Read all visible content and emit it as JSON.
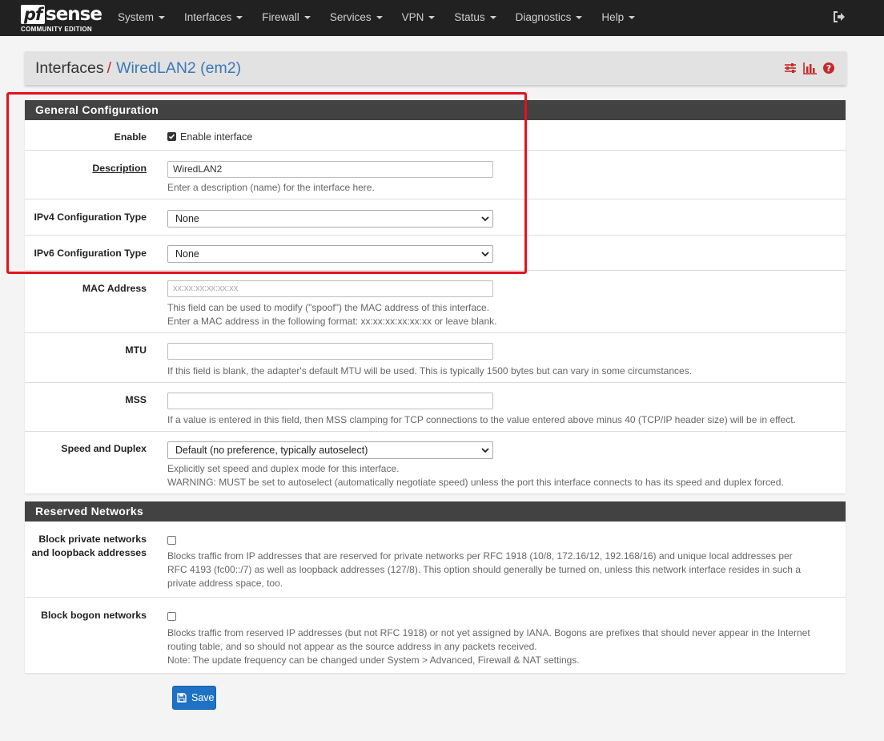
{
  "nav": {
    "logo_brand": "pfsense",
    "logo_pf": "pf",
    "logo_sense": "sense",
    "logo_edition": "COMMUNITY EDITION",
    "menu": [
      "System",
      "Interfaces",
      "Firewall",
      "Services",
      "VPN",
      "Status",
      "Diagnostics",
      "Help"
    ],
    "logout_icon": "sign-out-icon"
  },
  "breadcrumb": {
    "first": "Interfaces",
    "separator": "/",
    "current": "WiredLAN2 (em2)",
    "icons": [
      "sliders-icon",
      "bar-chart-icon",
      "question-circle-icon"
    ]
  },
  "general": {
    "heading": "General Configuration",
    "enable": {
      "label": "Enable",
      "checkbox_label": "Enable interface",
      "checked": true
    },
    "description": {
      "label": "Description",
      "value": "WiredLAN2",
      "help": "Enter a description (name) for the interface here."
    },
    "ipv4": {
      "label": "IPv4 Configuration Type",
      "value": "None"
    },
    "ipv6": {
      "label": "IPv6 Configuration Type",
      "value": "None"
    },
    "mac": {
      "label": "MAC Address",
      "placeholder": "xx:xx:xx:xx:xx:xx",
      "help1": "This field can be used to modify (\"spoof\") the MAC address of this interface.",
      "help2": "Enter a MAC address in the following format: xx:xx:xx:xx:xx:xx or leave blank."
    },
    "mtu": {
      "label": "MTU",
      "value": "",
      "help": "If this field is blank, the adapter's default MTU will be used. This is typically 1500 bytes but can vary in some circumstances."
    },
    "mss": {
      "label": "MSS",
      "value": "",
      "help": "If a value is entered in this field, then MSS clamping for TCP connections to the value entered above minus 40 (TCP/IP header size) will be in effect."
    },
    "speed": {
      "label": "Speed and Duplex",
      "value": "Default (no preference, typically autoselect)",
      "help1": "Explicitly set speed and duplex mode for this interface.",
      "help2": "WARNING: MUST be set to autoselect (automatically negotiate speed) unless the port this interface connects to has its speed and duplex forced."
    }
  },
  "reserved": {
    "heading": "Reserved Networks",
    "private": {
      "label1": "Block private networks",
      "label2": "and loopback addresses",
      "checked": false,
      "help1": "Blocks traffic from IP addresses that are reserved for private networks per RFC 1918 (10/8, 172.16/12, 192.168/16) and unique local addresses per",
      "help2": "RFC 4193 (fc00::/7) as well as loopback addresses (127/8). This option should generally be turned on, unless this network interface resides in such a",
      "help3": "private address space, too."
    },
    "bogon": {
      "label": "Block bogon networks",
      "checked": false,
      "help1": "Blocks traffic from reserved IP addresses (but not RFC 1918) or not yet assigned by IANA. Bogons are prefixes that should never appear in the Internet",
      "help2": "routing table, and so should not appear as the source address in any packets received.",
      "help3": "Note: The update frequency can be changed under System > Advanced, Firewall & NAT settings."
    }
  },
  "save_label": "Save",
  "colors": {
    "highlight": "#e4121e",
    "primary": "#1e72c5",
    "heading": "#424242",
    "navbar": "#212121"
  }
}
